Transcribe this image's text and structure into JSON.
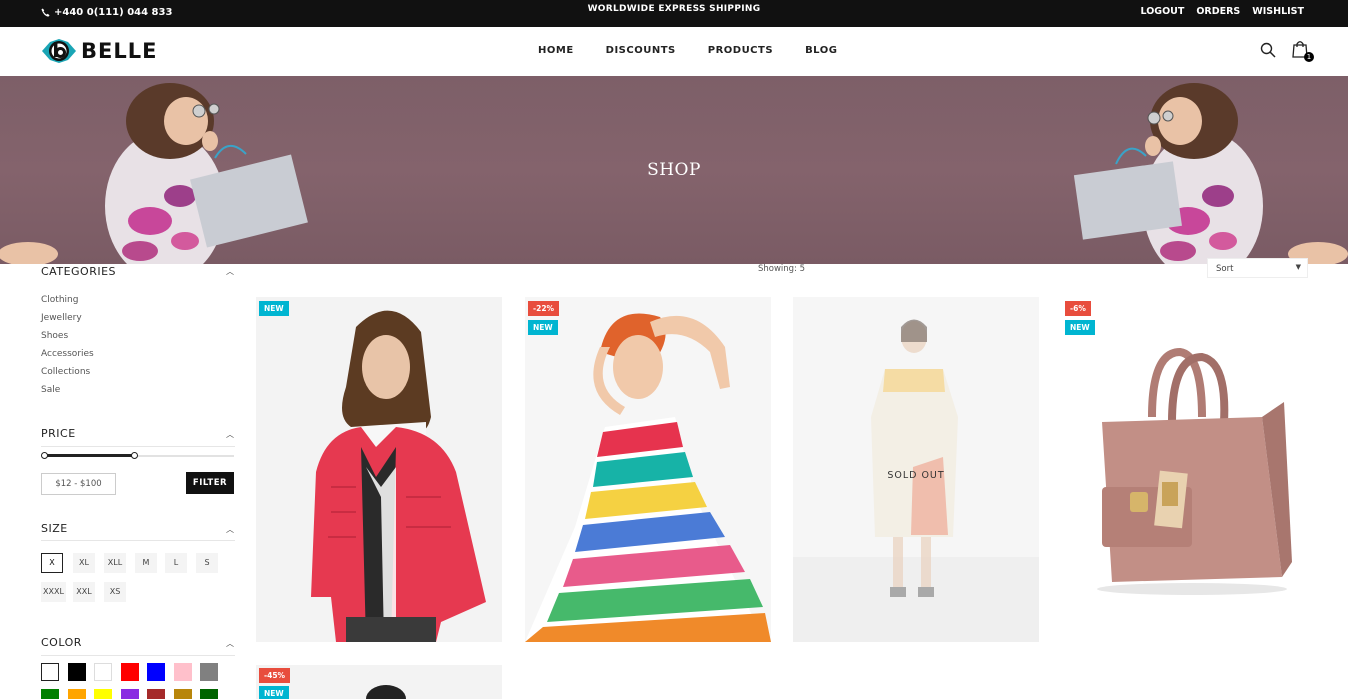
{
  "topbar": {
    "phone": "+440 0(111) 044 833",
    "shipping": "WORLDWIDE EXPRESS SHIPPING",
    "links": [
      "LOGOUT",
      "ORDERS",
      "WISHLIST"
    ]
  },
  "header": {
    "brand": "BELLE",
    "nav": [
      "HOME",
      "DISCOUNTS",
      "PRODUCTS",
      "BLOG"
    ],
    "cart_count": "1"
  },
  "banner": {
    "title": "SHOP"
  },
  "sidebar": {
    "categories": {
      "title": "CATEGORIES",
      "items": [
        "Clothing",
        "Jewellery",
        "Shoes",
        "Accessories",
        "Collections",
        "Sale"
      ]
    },
    "price": {
      "title": "PRICE",
      "range_text": "$12 - $100",
      "filter_label": "FILTER"
    },
    "size": {
      "title": "SIZE",
      "options": [
        "X",
        "XL",
        "XLL",
        "M",
        "L",
        "S",
        "XXXL",
        "XXL",
        "XS"
      ],
      "selected": "X"
    },
    "color": {
      "title": "COLOR",
      "swatches": [
        "#ffffff",
        "#000000",
        "#ffffff",
        "#ff0000",
        "#0000ff",
        "#ffc0cb",
        "#808080",
        "#008000",
        "#ffa500",
        "#ffff00",
        "#8a2be2",
        "#a52a2a",
        "#b8860b",
        "#006400"
      ]
    }
  },
  "listing": {
    "showing": "Showing: 5",
    "sort_label": "Sort",
    "products": [
      {
        "badges": [
          {
            "text": "NEW",
            "kind": "new"
          }
        ],
        "sold_out": ""
      },
      {
        "badges": [
          {
            "text": "-22%",
            "kind": "sale"
          },
          {
            "text": "NEW",
            "kind": "new"
          }
        ],
        "sold_out": ""
      },
      {
        "badges": [],
        "sold_out": "SOLD OUT"
      },
      {
        "badges": [
          {
            "text": "-6%",
            "kind": "sale"
          },
          {
            "text": "NEW",
            "kind": "new"
          }
        ],
        "sold_out": ""
      },
      {
        "badges": [
          {
            "text": "-45%",
            "kind": "sale"
          },
          {
            "text": "NEW",
            "kind": "new"
          }
        ],
        "sold_out": ""
      }
    ]
  }
}
